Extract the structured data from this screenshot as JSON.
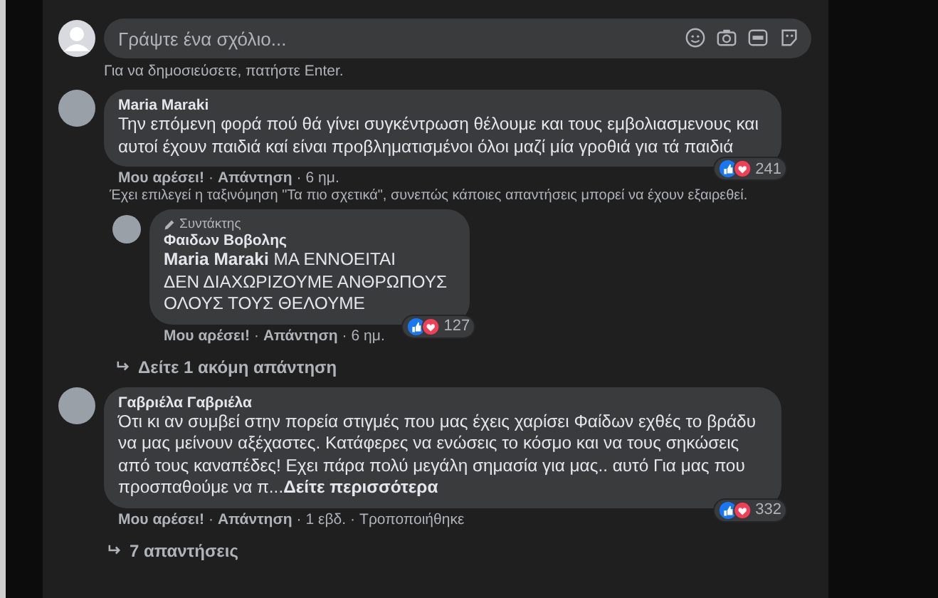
{
  "separator": "·",
  "composer": {
    "placeholder": "Γράψτε ένα σχόλιο...",
    "hint": "Για να δημοσιεύσετε, πατήστε Enter."
  },
  "comments": [
    {
      "author": "Maria Maraki",
      "text": "Την επόμενη φορά πού θά γίνει συγκέντρωση θέλουμε και τους εμβολιασμενους και αυτοί έχουν παιδιά καί είναι προβληματισμένοι όλοι μαζί μία γροθιά για τά παιδιά",
      "like": "Μου αρέσει!",
      "reply": "Απάντηση",
      "time": "6 ημ.",
      "reactions": "241",
      "note": "Έχει επιλεγεί η ταξινόμηση \"Τα πιο σχετικά\", συνεπώς κάποιες απαντήσεις μπορεί να έχουν εξαιρεθεί.",
      "replies": [
        {
          "badge": "Συντάκτης",
          "author": "Φαιδων Βοβολης",
          "text": "**Maria Maraki** ΜΑ ΕΝΝΟΕΙΤΑΙ\nΔΕΝ ΔΙΑΧΩΡΙΖΟΥΜΕ ΑΝΘΡΩΠΟΥΣ\nΟΛΟΥΣ ΤΟΥΣ ΘΕΛΟΥΜΕ",
          "like": "Μου αρέσει!",
          "reply": "Απάντηση",
          "time": "6 ημ.",
          "reactions": "127"
        }
      ],
      "more": "Δείτε 1 ακόμη απάντηση"
    },
    {
      "author": "Γαβριέλα Γαβριέλα",
      "text": "Ότι κι αν συμβεί στην πορεία στιγμές που μας έχεις χαρίσει Φαίδων εχθές το βράδυ να μας μείνουν αξέχαστες. Κατάφερες να ενώσεις το κόσμο και να τους σηκώσεις από τους καναπέδες! Εχει πάρα πολύ μεγάλη σημασία για μας.. αυτό Για μας που προσπαθούμε να π...",
      "see_more": "Δείτε περισσότερα",
      "like": "Μου αρέσει!",
      "reply": "Απάντηση",
      "time": "1 εβδ.",
      "edited": "Τροποποιήθηκε",
      "reactions": "332",
      "more": "7 απαντήσεις"
    }
  ]
}
